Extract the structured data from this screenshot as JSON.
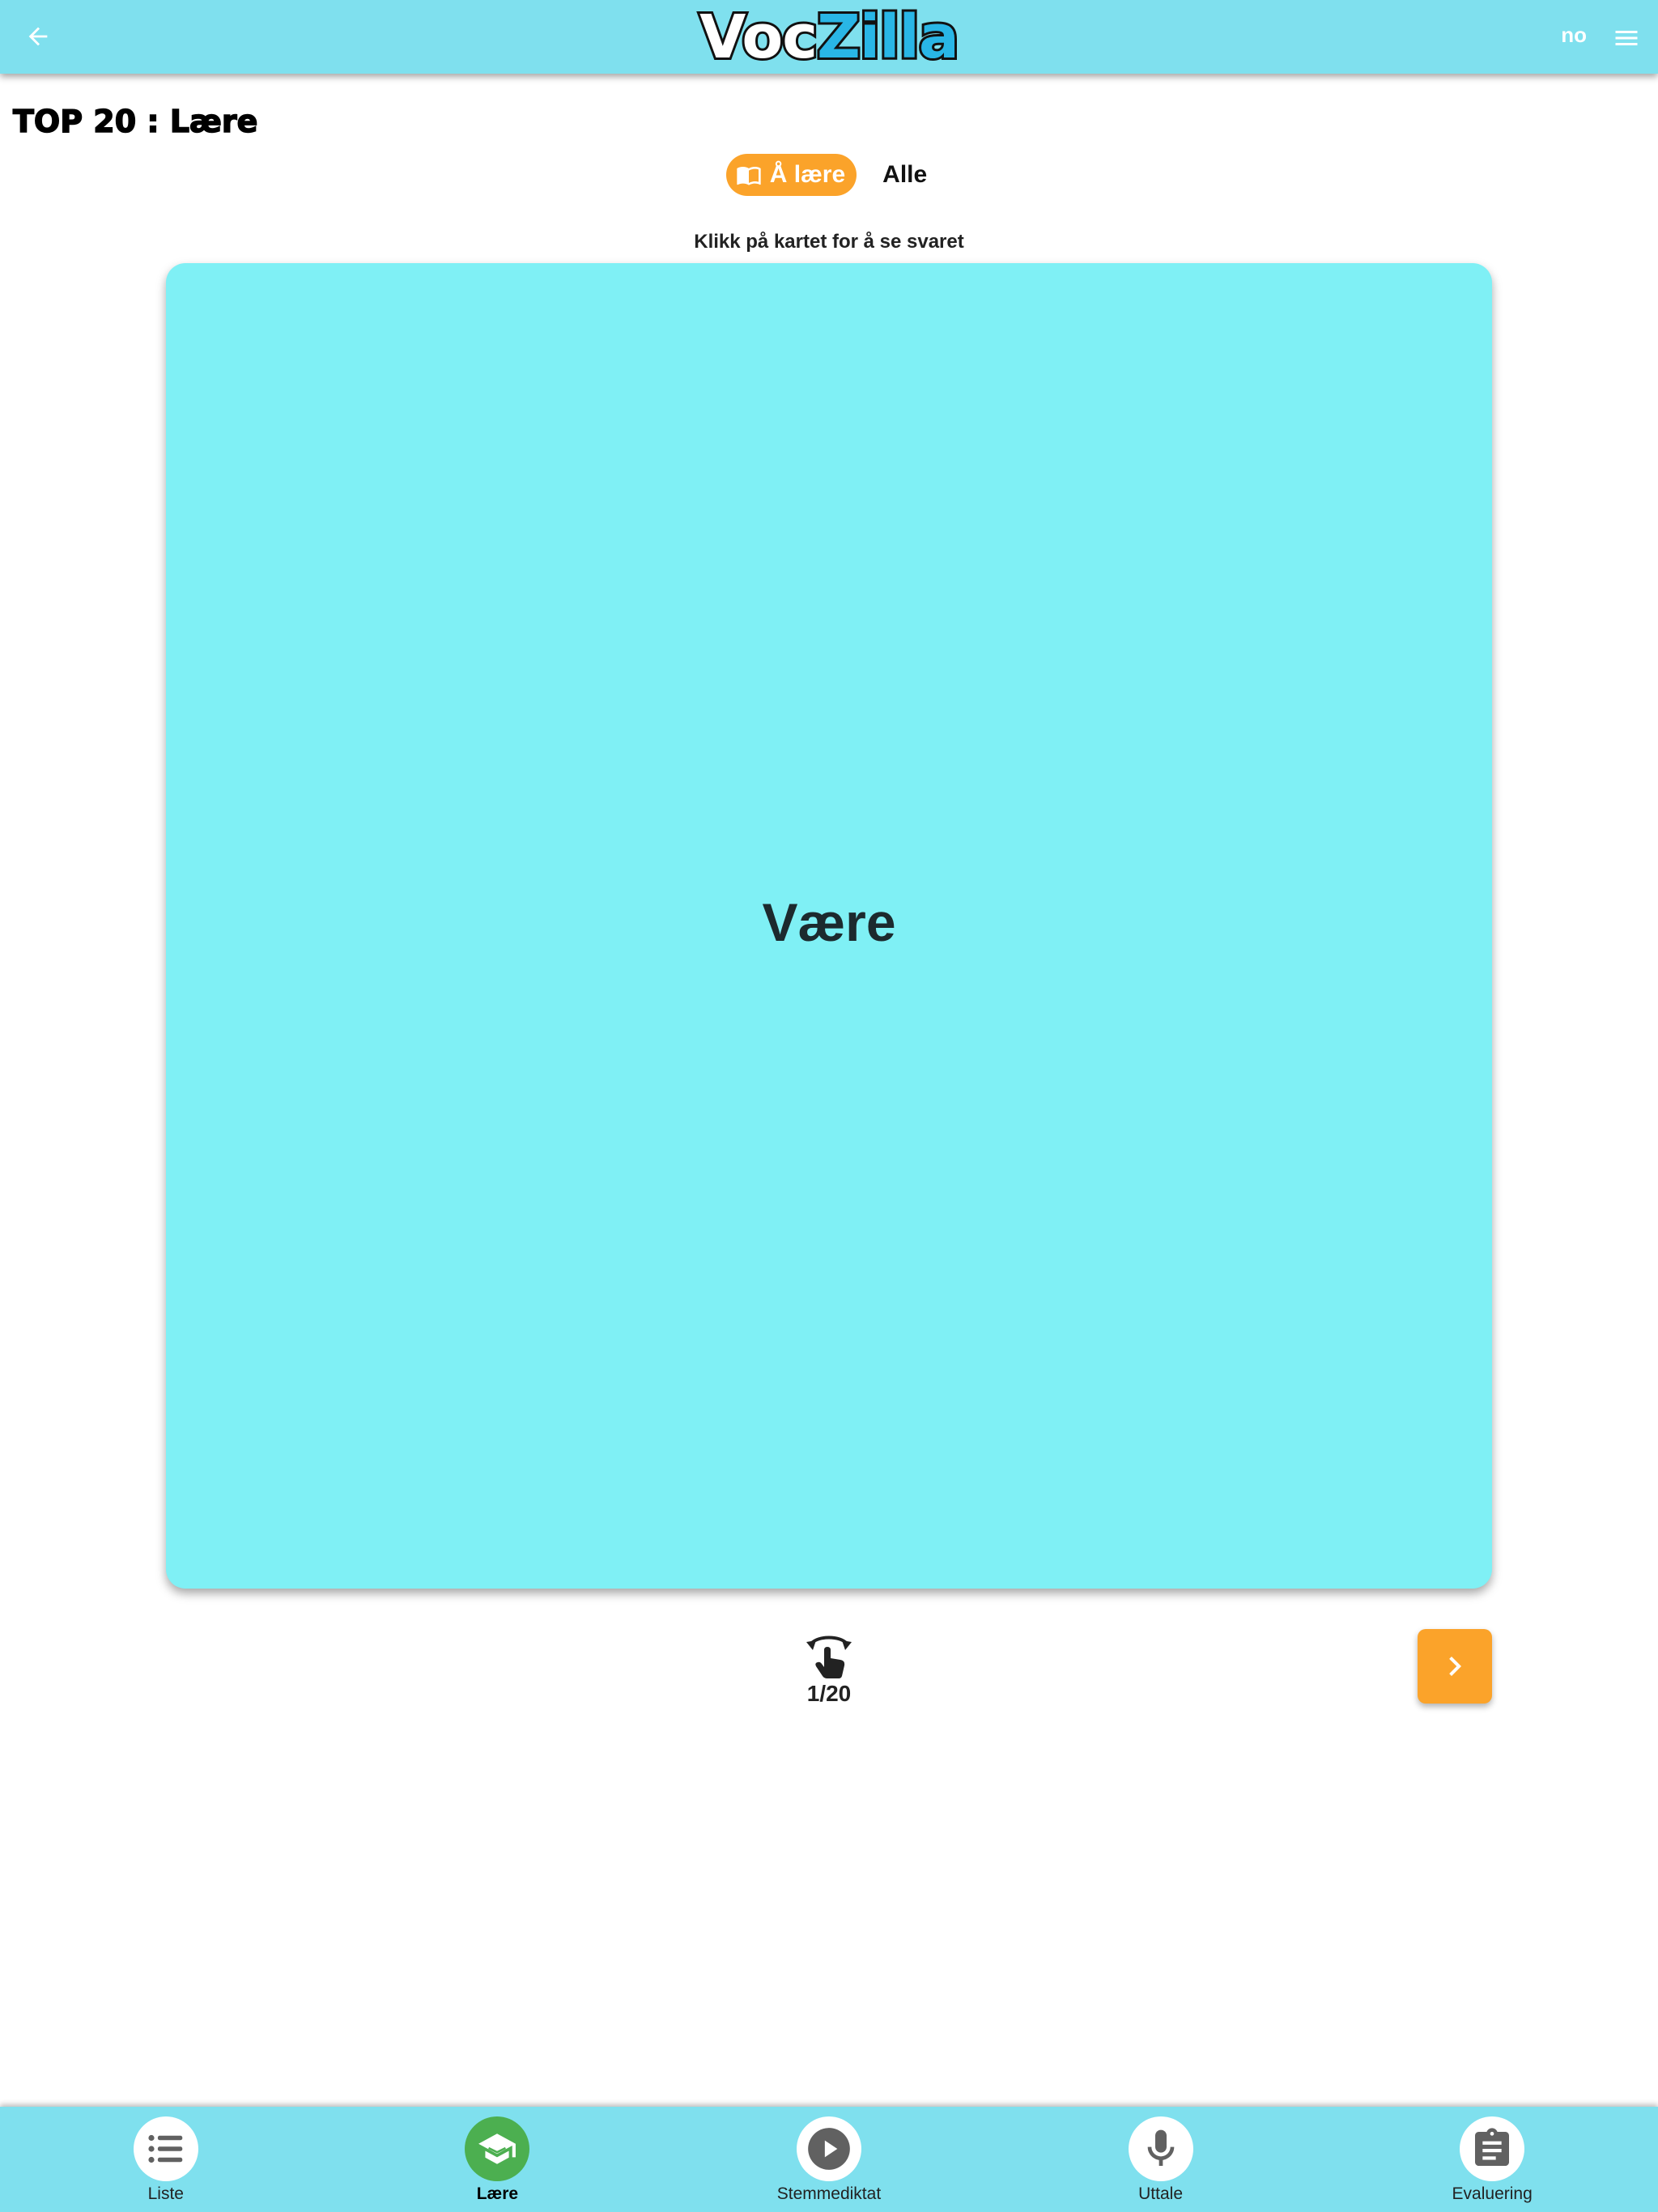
{
  "appbar": {
    "logo_part1": "Voc",
    "logo_part2": "Zilla",
    "language": "no"
  },
  "page": {
    "title": "TOP 20 : Lære"
  },
  "toggle": {
    "active_label": "Å lære",
    "other_label": "Alle"
  },
  "hint": "Klikk på kartet for å se svaret",
  "card": {
    "word": "Være"
  },
  "counter": "1/20",
  "bottom_nav": {
    "items": [
      {
        "label": "Liste",
        "icon": "list-icon"
      },
      {
        "label": "Lære",
        "icon": "graduation-cap-icon",
        "active": true
      },
      {
        "label": "Stemmediktat",
        "icon": "play-icon"
      },
      {
        "label": "Uttale",
        "icon": "microphone-icon"
      },
      {
        "label": "Evaluering",
        "icon": "clipboard-icon"
      }
    ]
  },
  "colors": {
    "appbar": "#7fe0ee",
    "card": "#7ff0f5",
    "accent": "#fba32a",
    "active_nav": "#4caf50"
  }
}
